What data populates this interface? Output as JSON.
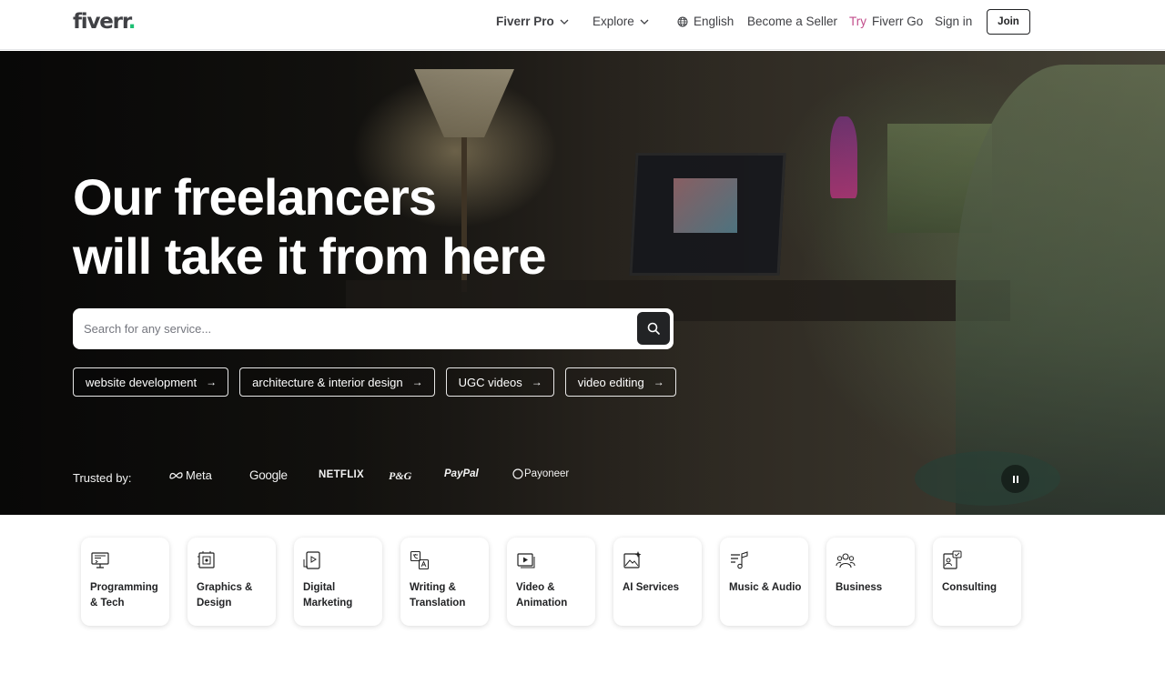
{
  "header": {
    "logo_text": "fiverr",
    "logo_dot": ".",
    "nav": {
      "fiverr_pro": "Fiverr Pro",
      "explore": "Explore",
      "language": "English",
      "become_seller": "Become a Seller",
      "try_go_prefix": "Try ",
      "try_go_suffix": "Fiverr Go",
      "sign_in": "Sign in",
      "join": "Join"
    }
  },
  "hero": {
    "title_line1": "Our freelancers",
    "title_line2": "will take it from here",
    "search_placeholder": "Search for any service...",
    "chips": [
      "website development",
      "architecture & interior design",
      "UGC videos",
      "video editing"
    ],
    "trusted_label": "Trusted by:",
    "brands": [
      "Meta",
      "Google",
      "NETFLIX",
      "P&G",
      "PayPal",
      "Payoneer"
    ]
  },
  "categories": [
    {
      "label": "Programming & Tech",
      "icon": "monitor-code-icon"
    },
    {
      "label": "Graphics & Design",
      "icon": "design-frame-icon"
    },
    {
      "label": "Digital Marketing",
      "icon": "marketing-icon"
    },
    {
      "label": "Writing & Translation",
      "icon": "translate-icon"
    },
    {
      "label": "Video & Animation",
      "icon": "video-play-icon"
    },
    {
      "label": "AI Services",
      "icon": "ai-image-icon"
    },
    {
      "label": "Music & Audio",
      "icon": "music-icon"
    },
    {
      "label": "Business",
      "icon": "team-icon"
    },
    {
      "label": "Consulting",
      "icon": "consulting-icon"
    }
  ],
  "colors": {
    "brand_green": "#1dbf73",
    "text_dark": "#222325",
    "try_go_pink": "#c24d8b"
  }
}
